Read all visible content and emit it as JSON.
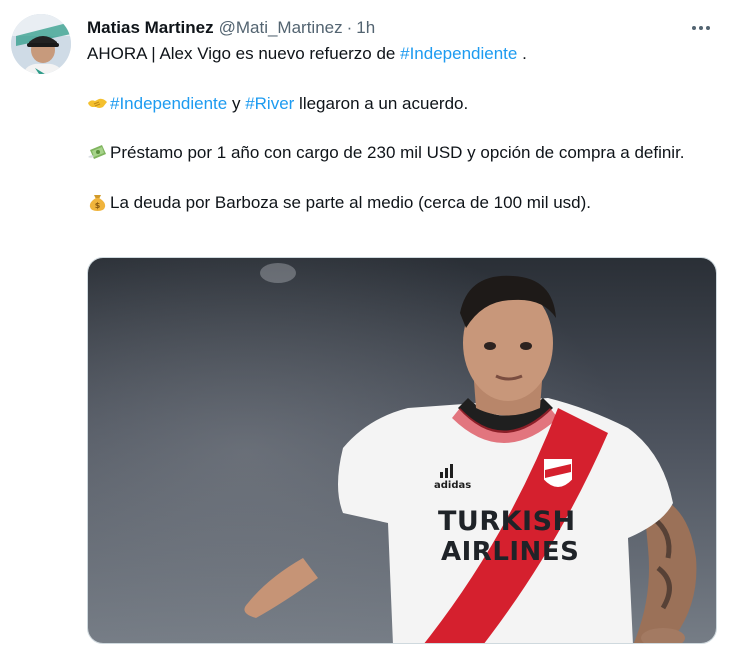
{
  "tweet": {
    "author_name": "Matias Martinez",
    "author_handle": "@Mati_Martinez",
    "separator": "·",
    "time": "1h",
    "avatar_icon": "avatar-photo",
    "more_icon": "more-options-icon",
    "line1_text": "AHORA | Alex Vigo es nuevo refuerzo de ",
    "line1_hashtag": "#Independiente",
    "line1_end": " .",
    "line2_emoji": "handshake-emoji",
    "line2_hashtag1": "#Independiente",
    "line2_mid": " y ",
    "line2_hashtag2": "#River",
    "line2_end": " llegaron a un acuerdo.",
    "line3_emoji": "money-with-wings-emoji",
    "line3_text": "Préstamo por 1 año con cargo de 230 mil USD y opción de compra a definir.",
    "line4_emoji": "money-bag-emoji",
    "line4_text": "La deuda por Barboza se parte al medio (cerca de 100 mil usd).",
    "media": {
      "jersey_sponsor_line1": "TURKISH",
      "jersey_sponsor_line2": "AIRLINES",
      "jersey_brand": "adidas"
    }
  },
  "colors": {
    "hashtag": "#1d9bf0",
    "secondary_text": "#536471",
    "jersey_red": "#d5202e"
  }
}
